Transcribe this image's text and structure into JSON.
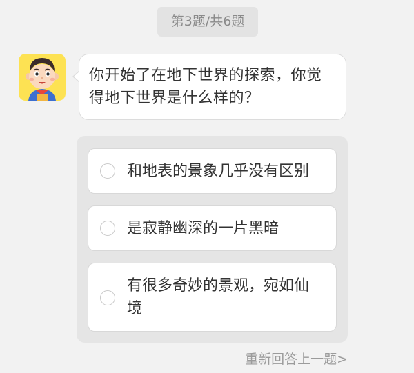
{
  "progress": {
    "label": "第3题/共6题"
  },
  "avatar": {
    "icon": "cartoon-child-avatar-icon",
    "background": "#fde253"
  },
  "question": {
    "text": "你开始了在地下世界的探索，你觉得地下世界是什么样的？"
  },
  "options": [
    {
      "label": "和地表的景象几乎没有区别",
      "selected": false
    },
    {
      "label": "是寂静幽深的一片黑暗",
      "selected": false
    },
    {
      "label": "有很多奇妙的景观，宛如仙境",
      "selected": false
    }
  ],
  "footer": {
    "redo_label": "重新回答上一题>"
  },
  "colors": {
    "page_background": "#f2f2f2",
    "bubble_background": "#ffffff",
    "panel_background": "#e5e5e5",
    "muted_text": "#9b9b9b"
  }
}
